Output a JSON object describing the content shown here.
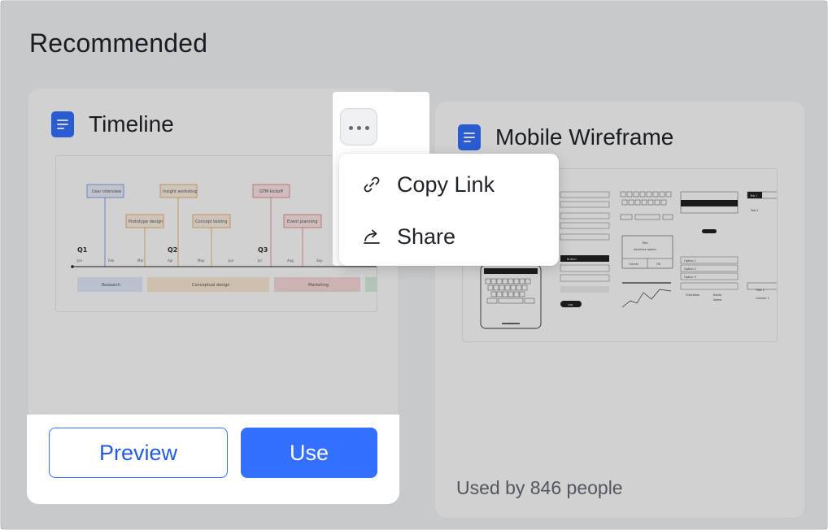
{
  "section": {
    "title": "Recommended"
  },
  "cards": [
    {
      "title": "Timeline",
      "thumb": {
        "quarters": [
          "Q1",
          "Q2",
          "Q3"
        ],
        "months": [
          "Jan",
          "Feb",
          "Mar",
          "Apr",
          "May",
          "Jun",
          "Jul",
          "Aug",
          "Sep"
        ],
        "milestones_top": [
          "User interview",
          "Insight workshop",
          "GTM kickoff"
        ],
        "milestones_mid": [
          "Prototype design",
          "Concept testing",
          "Event planning"
        ],
        "phases": [
          "Research",
          "Conceptual design",
          "Marketing"
        ]
      }
    },
    {
      "title": "Mobile Wireframe",
      "used_by": "Used by 846 people",
      "thumb": {
        "labels": [
          "Title",
          "Interface option",
          "Cancel",
          "OK",
          "Option 1",
          "Option 2",
          "Option 3",
          "Tab 1",
          "Tab 2",
          "Button",
          "Log",
          "Checkbox",
          "Radio",
          "Name",
          "Title 1",
          "Column 1"
        ]
      }
    }
  ],
  "more_menu": {
    "items": [
      {
        "label": "Copy Link",
        "icon": "link-icon"
      },
      {
        "label": "Share",
        "icon": "share-icon"
      }
    ]
  },
  "actions": {
    "preview_label": "Preview",
    "use_label": "Use"
  },
  "colors": {
    "accent": "#3370ff",
    "doc_icon": "#3370ff",
    "text": "#1f2329",
    "muted": "#646a73"
  }
}
